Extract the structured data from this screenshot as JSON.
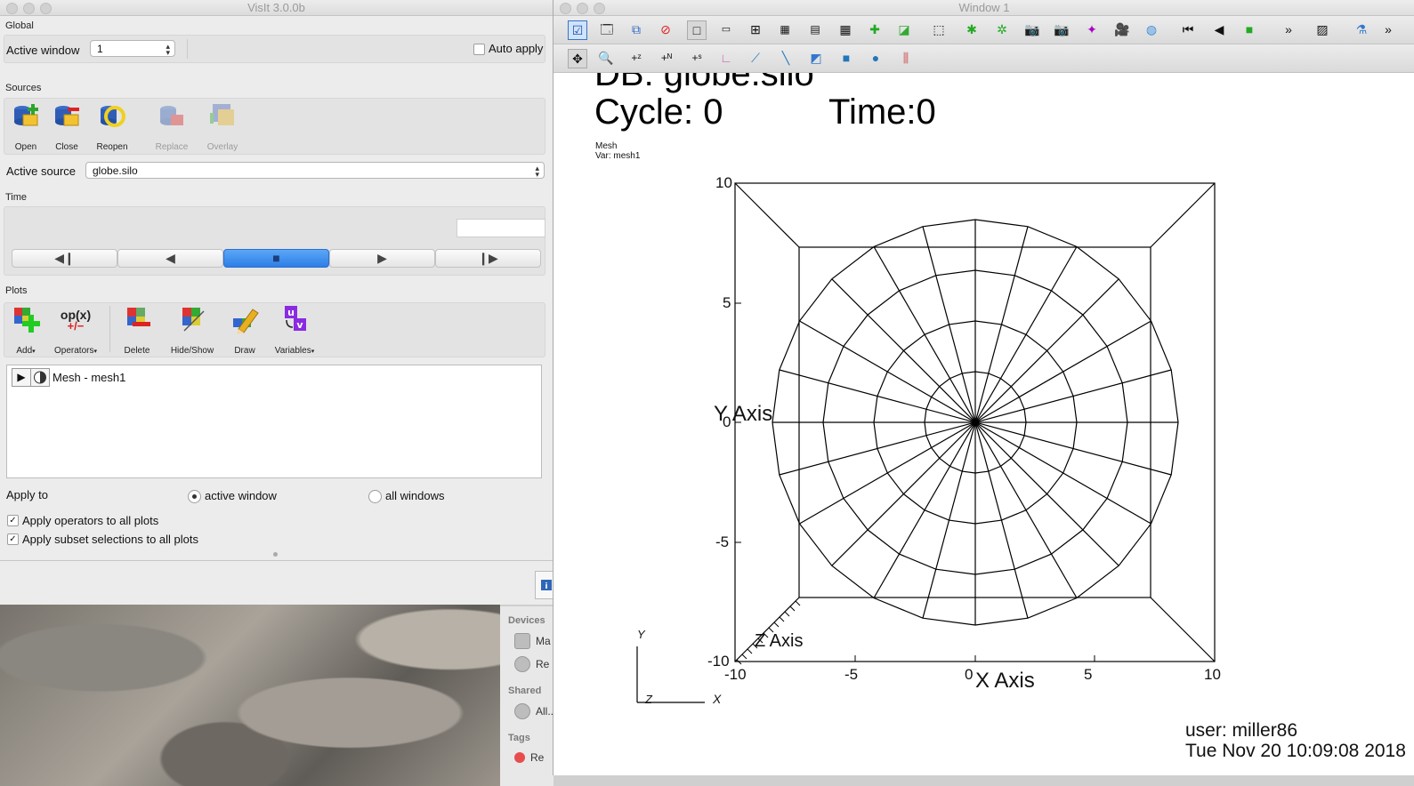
{
  "gui": {
    "title": "VisIt 3.0.0b",
    "global_label": "Global",
    "active_window_label": "Active window",
    "active_window_value": "1",
    "auto_apply_label": "Auto apply",
    "sources_label": "Sources",
    "sources_buttons": [
      {
        "label": "Open",
        "enabled": true
      },
      {
        "label": "Close",
        "enabled": true
      },
      {
        "label": "Reopen",
        "enabled": true
      },
      {
        "label": "Replace",
        "enabled": false
      },
      {
        "label": "Overlay",
        "enabled": false
      }
    ],
    "active_source_label": "Active source",
    "active_source_value": "globe.silo",
    "time_label": "Time",
    "time_value": "",
    "plots_label": "Plots",
    "plots_buttons": [
      {
        "label": "Add"
      },
      {
        "label": "Operators"
      },
      {
        "label": "Delete"
      },
      {
        "label": "Hide/Show"
      },
      {
        "label": "Draw"
      },
      {
        "label": "Variables"
      }
    ],
    "operators_icon_text": "op(x)",
    "plot_list": [
      {
        "name": "Mesh - mesh1"
      }
    ],
    "apply_to_label": "Apply to",
    "apply_active_window": "active window",
    "apply_all_windows": "all windows",
    "apply_operators_label": "Apply operators to all plots",
    "apply_subset_label": "Apply subset selections to all plots"
  },
  "finder": {
    "devices_label": "Devices",
    "devices_items": [
      "Ma",
      "Re"
    ],
    "shared_label": "Shared",
    "shared_items": [
      "All..."
    ],
    "tags_label": "Tags",
    "tags_items": [
      "Re"
    ]
  },
  "viewer": {
    "title": "Window 1",
    "db_text": "DB: globe.silo",
    "cycle_text": "Cycle: 0",
    "time_text": "Time:0",
    "plot_name": "Mesh",
    "plot_var": "Var: mesh1",
    "x_axis_title": "X Axis",
    "y_axis_title": "Y Axis",
    "z_axis_title": "Z Axis",
    "x_ticks": [
      "-10",
      "-5",
      "0",
      "5",
      "10"
    ],
    "y_ticks": [
      "10",
      "5",
      "0",
      "-5",
      "-10"
    ],
    "triad": {
      "x": "X",
      "y": "Y",
      "z": "Z"
    },
    "user_text": "user: miller86",
    "date_text": "Tue Nov 20 10:09:08 2018",
    "mesh": {
      "radial_spokes": 24,
      "rings": 4
    }
  },
  "colors": {
    "accent": "#2d7ee6",
    "mesh": "#000000",
    "tag_red": "#e84c4c"
  }
}
